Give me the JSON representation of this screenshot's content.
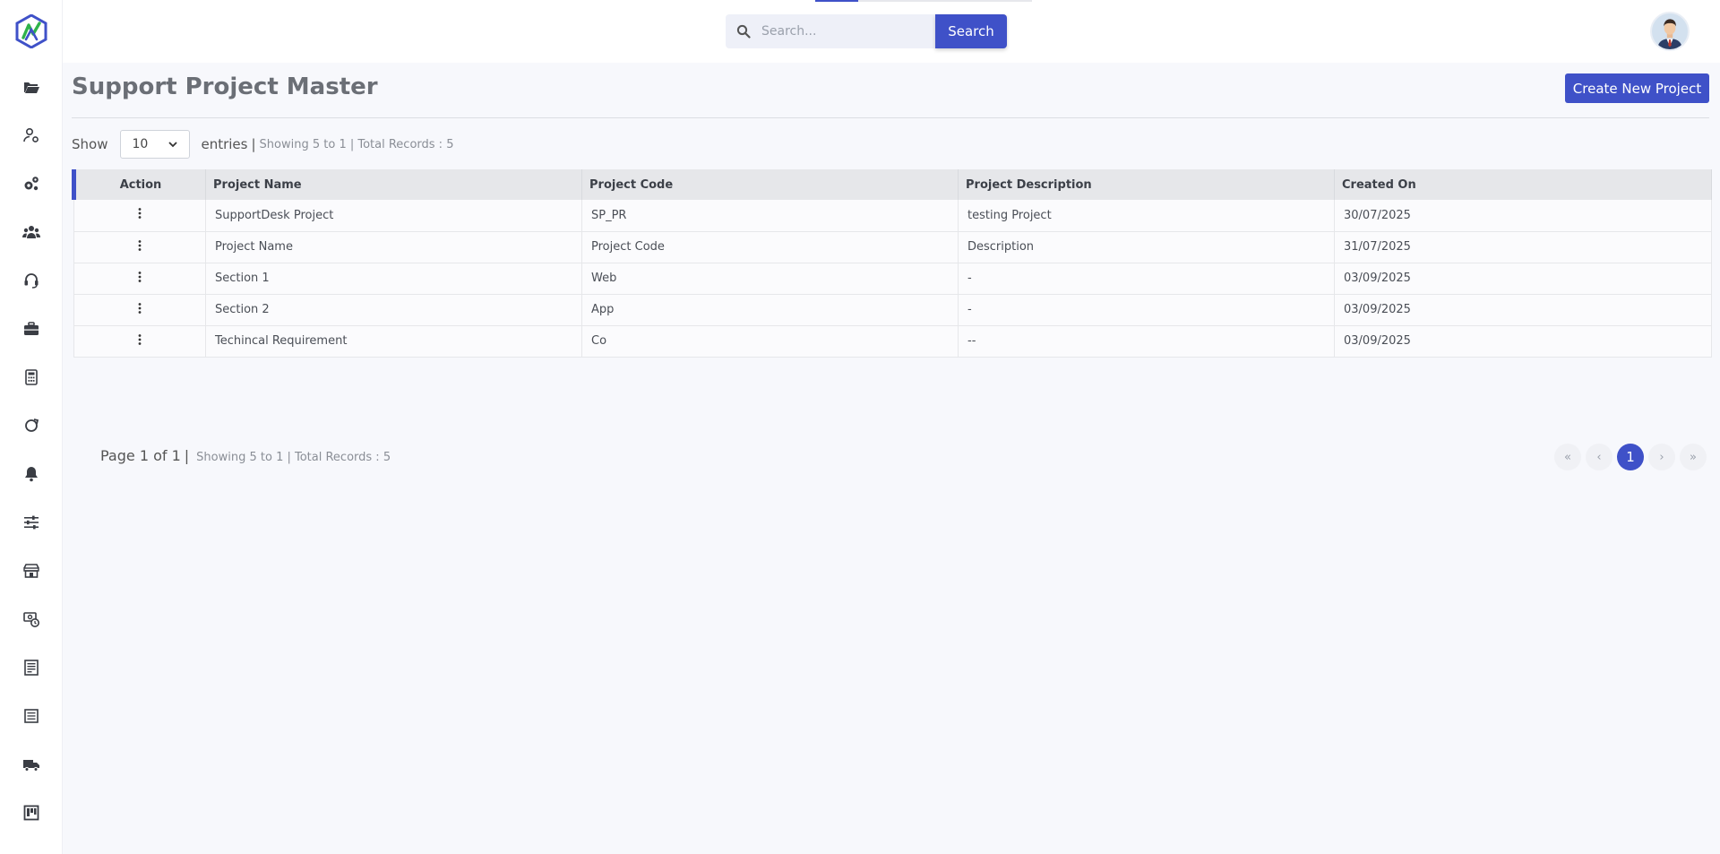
{
  "header": {
    "search_placeholder": "Search...",
    "search_button": "Search"
  },
  "page": {
    "title": "Support Project Master",
    "create_button": "Create New Project"
  },
  "entries": {
    "show_label": "Show",
    "selected": "10",
    "entries_label": "entries",
    "info": "Showing 5 to 1 | Total Records : 5"
  },
  "table": {
    "headers": [
      "Action",
      "Project Name",
      "Project Code",
      "Project Description",
      "Created On"
    ],
    "rows": [
      [
        "SupportDesk Project",
        "SP_PR",
        "testing Project",
        "30/07/2025"
      ],
      [
        "Project Name",
        "Project Code",
        "Description",
        "31/07/2025"
      ],
      [
        "Section 1",
        "Web",
        "-",
        "03/09/2025"
      ],
      [
        "Section 2",
        "App",
        "-",
        "03/09/2025"
      ],
      [
        "Techincal Requirement",
        "Co",
        "--",
        "03/09/2025"
      ]
    ]
  },
  "footer": {
    "page_label": "Page 1 of 1",
    "info": "Showing 5 to 1 | Total Records : 5",
    "pager": {
      "first": "«",
      "prev": "‹",
      "current": "1",
      "next": "›",
      "last": "»"
    }
  },
  "colors": {
    "accent": "#3f51c8",
    "background": "#f7f8fc"
  },
  "sidebar_icons": [
    "folder-open-icon",
    "user-gear-icon",
    "gears-icon",
    "users-icon",
    "headset-icon",
    "briefcase-icon",
    "calculator-icon",
    "circle-arrow-icon",
    "bell-icon",
    "sliders-icon",
    "store-icon",
    "money-clock-icon",
    "report-icon",
    "list-icon",
    "truck-icon",
    "kanban-icon"
  ]
}
